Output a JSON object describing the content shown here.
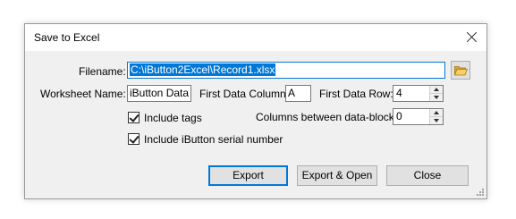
{
  "window": {
    "title": "Save to Excel"
  },
  "form": {
    "filename_label": "Filename:",
    "filename_value": "C:\\iButton2Excel\\Record1.xlsx",
    "worksheet_label": "Worksheet Name:",
    "worksheet_value": "iButton Data",
    "first_col_label": "First Data Column:",
    "first_col_value": "A",
    "first_row_label": "First Data Row:",
    "first_row_value": "4",
    "include_tags_label": "Include tags",
    "include_tags_checked": true,
    "cols_between_label": "Columns between data-blocks:",
    "cols_between_value": "0",
    "include_serial_label": "Include iButton serial number",
    "include_serial_checked": true
  },
  "buttons": {
    "export": "Export",
    "export_open": "Export & Open",
    "close": "Close"
  },
  "icons": {
    "browse": "open-folder-icon",
    "close": "close-icon"
  },
  "colors": {
    "accent": "#0078d7",
    "folder": "#e8b64c"
  }
}
